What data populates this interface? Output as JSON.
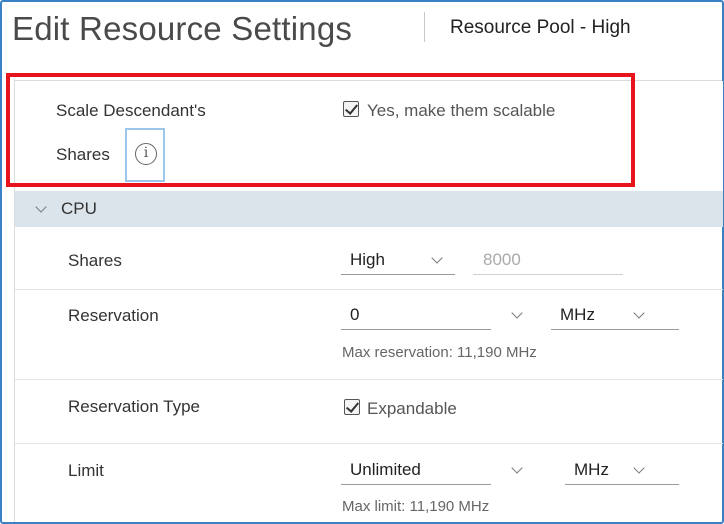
{
  "header": {
    "title": "Edit Resource Settings",
    "subtitle": "Resource Pool - High"
  },
  "scale_descendants": {
    "label_line1": "Scale Descendant's",
    "label_line2": "Shares",
    "info_icon": "info-icon",
    "checkbox_checked": true,
    "checkbox_label": "Yes, make them scalable"
  },
  "cpu": {
    "section_title": "CPU",
    "shares": {
      "label": "Shares",
      "level": "High",
      "value": "8000"
    },
    "reservation": {
      "label": "Reservation",
      "value": "0",
      "unit": "MHz",
      "hint": "Max reservation: 11,190 MHz"
    },
    "reservation_type": {
      "label": "Reservation Type",
      "checked": true,
      "checkbox_label": "Expandable"
    },
    "limit": {
      "label": "Limit",
      "value": "Unlimited",
      "unit": "MHz",
      "hint": "Max limit: 11,190 MHz"
    }
  },
  "colors": {
    "highlight": "#e8141d",
    "section_header_bg": "#dbe4ea",
    "frame_border": "#3b82c4",
    "info_focus": "#9cc6ea"
  }
}
